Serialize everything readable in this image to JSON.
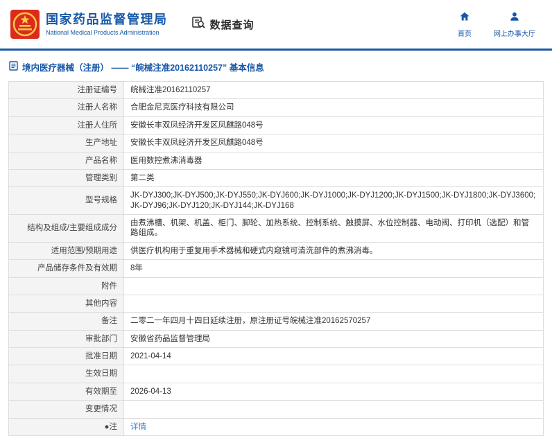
{
  "header": {
    "agency_cn": "国家药品监督管理局",
    "agency_en": "National Medical Products Administration",
    "section_title": "数据查询",
    "nav": [
      {
        "label": "首页",
        "icon": "home-icon"
      },
      {
        "label": "网上办事大厅",
        "icon": "person-icon"
      }
    ]
  },
  "breadcrumb": {
    "text": "境内医疗器械（注册） —— “皖械注准20162110257” 基本信息"
  },
  "icons": {
    "logo": "national-emblem",
    "query": "document-with-magnifier",
    "breadcrumb": "document"
  },
  "colors": {
    "brand_blue": "#1658a7",
    "emblem_red": "#dd2a1b",
    "emblem_gold": "#f7c948",
    "link_blue": "#2f7cd1",
    "label_bg": "#f4f4f4",
    "border": "#dcdcdc"
  },
  "table": {
    "rows": [
      {
        "label": "注册证编号",
        "value": "皖械注准20162110257"
      },
      {
        "label": "注册人名称",
        "value": "合肥金尼克医疗科技有限公司"
      },
      {
        "label": "注册人住所",
        "value": "安徽长丰双凤经济开发区凤麒路048号"
      },
      {
        "label": "生产地址",
        "value": "安徽长丰双凤经济开发区凤麒路048号"
      },
      {
        "label": "产品名称",
        "value": "医用数控煮沸消毒器"
      },
      {
        "label": "管理类别",
        "value": "第二类"
      },
      {
        "label": "型号规格",
        "value": "JK-DYJ300;JK-DYJ500;JK-DYJ550;JK-DYJ600;JK-DYJ1000;JK-DYJ1200;JK-DYJ1500;JK-DYJ1800;JK-DYJ3600;JK-DYJ96;JK-DYJ120;JK-DYJ144;JK-DYJ168"
      },
      {
        "label": "结构及组成/主要组成成分",
        "value": "由煮沸槽、机架、机盖、柜门、脚轮、加热系统、控制系统、触摸屏、水位控制器、电动阀、打印机（选配）和管路组成。"
      },
      {
        "label": "适用范围/预期用途",
        "value": "供医疗机构用于重复用手术器械和硬式内窥镜可清洗部件的煮沸消毒。"
      },
      {
        "label": "产品储存条件及有效期",
        "value": "8年"
      },
      {
        "label": "附件",
        "value": ""
      },
      {
        "label": "其他内容",
        "value": ""
      },
      {
        "label": "备注",
        "value": "二零二一年四月十四日延续注册，原注册证号皖械注准20162570257"
      },
      {
        "label": "审批部门",
        "value": "安徽省药品监督管理局"
      },
      {
        "label": "批准日期",
        "value": "2021-04-14"
      },
      {
        "label": "生效日期",
        "value": ""
      },
      {
        "label": "有效期至",
        "value": "2026-04-13"
      },
      {
        "label": "变更情况",
        "value": ""
      },
      {
        "label": "●注",
        "value": "详情"
      }
    ]
  }
}
